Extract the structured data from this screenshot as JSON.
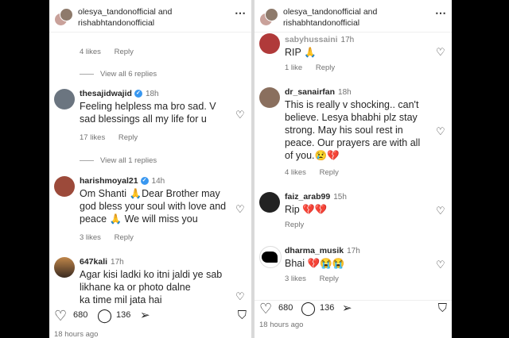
{
  "left": {
    "header": {
      "user1": "olesya_tandonofficial",
      "and": "and",
      "user2": "rishabhtandonofficial"
    },
    "top_meta": {
      "likes": "4 likes",
      "reply": "Reply"
    },
    "view_replies_1": "View all 6 replies",
    "comment1": {
      "user": "thesajidwajid",
      "time": "18h",
      "text": "Feeling helpless ma bro sad. V sad blessings all my life for u",
      "likes": "17 likes",
      "reply": "Reply"
    },
    "view_replies_2": "View all 1 replies",
    "comment2": {
      "user": "harishmoyal21",
      "time": "14h",
      "text": "Om Shanti 🙏Dear Brother may god bless your soul with love and peace 🙏 We will miss you",
      "likes": "3 likes",
      "reply": "Reply"
    },
    "comment3": {
      "user": "647kali",
      "time": "17h",
      "text": "Agar kisi ladki ko itni jaldi ye sab likhane ka or photo dalne",
      "text_cut": "ka time mil jata hai"
    },
    "actions": {
      "likes": "680",
      "comments": "136"
    },
    "timestamp": "18 hours ago"
  },
  "right": {
    "header": {
      "user1": "olesya_tandonofficial",
      "and": "and",
      "user2": "rishabhtandonofficial"
    },
    "comment0": {
      "user": "sabyhussaini",
      "time": "17h",
      "text": "RIP 🙏",
      "likes": "1 like",
      "reply": "Reply"
    },
    "comment1": {
      "user": "dr_sanairfan",
      "time": "18h",
      "text": "This is really v shocking.. can't believe. Lesya bhabhi plz stay strong. May his soul rest in peace. Our prayers are with all of you.😢💔",
      "likes": "4 likes",
      "reply": "Reply"
    },
    "comment2": {
      "user": "faiz_arab99",
      "time": "15h",
      "text": "Rip 💔💔",
      "reply": "Reply"
    },
    "comment3": {
      "user": "dharma_musik",
      "time": "17h",
      "text": "Bhai 💔😭😭",
      "likes": "3 likes",
      "reply": "Reply"
    },
    "actions": {
      "likes": "680",
      "comments": "136"
    },
    "timestamp": "18 hours ago"
  },
  "colors": {
    "verified": "#3897f0",
    "text": "#262626",
    "muted": "#737373"
  }
}
